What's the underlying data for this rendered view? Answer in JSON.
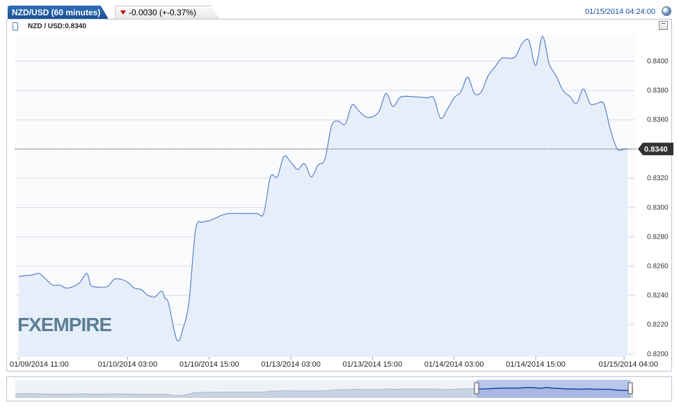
{
  "tab": {
    "pair_label": "NZD/USD (60 minutes)",
    "change_label": "-0.0030 (+-0.37%)",
    "datetime": "01/15/2014 04:24:00"
  },
  "colors": {
    "line": "#5a82c8",
    "fill": "#e6eefa",
    "tab": "#1b4f94",
    "down": "#cc0000",
    "label_bg": "#333333"
  },
  "logo_text": "FXEMPIRE",
  "chart_data": {
    "type": "area",
    "series_label": "NZD / USD:0.8340",
    "last_value_label": "0.8340",
    "last_value": 0.834,
    "ylim": [
      0.8198,
      0.8418
    ],
    "yticks": [
      "0.8200",
      "0.8220",
      "0.8240",
      "0.8260",
      "0.8280",
      "0.8300",
      "0.8320",
      "0.8340",
      "0.8360",
      "0.8380",
      "0.8400"
    ],
    "ytick_values": [
      0.82,
      0.822,
      0.824,
      0.826,
      0.828,
      0.83,
      0.832,
      0.834,
      0.836,
      0.838,
      0.84
    ],
    "xticks": [
      "01/09/2014 11:00",
      "01/10/2014 03:00",
      "01/10/2014 15:00",
      "01/13/2014 03:00",
      "01/13/2014 15:00",
      "01/14/2014 03:00",
      "01/14/2014 15:00",
      "01/15/2014 04:00"
    ],
    "x_hours_tick_positions": [
      0,
      16,
      28,
      40,
      52,
      64,
      76,
      89
    ],
    "points": [
      [
        0,
        0.8253
      ],
      [
        2,
        0.8254
      ],
      [
        3,
        0.8255
      ],
      [
        4,
        0.8251
      ],
      [
        5,
        0.8247
      ],
      [
        6,
        0.8247
      ],
      [
        7,
        0.8245
      ],
      [
        8,
        0.8246
      ],
      [
        9,
        0.8249
      ],
      [
        10,
        0.8255
      ],
      [
        10.5,
        0.8248
      ],
      [
        11,
        0.8246
      ],
      [
        13,
        0.8246
      ],
      [
        14,
        0.8251
      ],
      [
        15,
        0.8251
      ],
      [
        16,
        0.8249
      ],
      [
        17,
        0.8245
      ],
      [
        18,
        0.8244
      ],
      [
        19,
        0.824
      ],
      [
        20,
        0.8239
      ],
      [
        21,
        0.8243
      ],
      [
        21.5,
        0.8238
      ],
      [
        22,
        0.8235
      ],
      [
        23,
        0.8213
      ],
      [
        23.5,
        0.8209
      ],
      [
        24,
        0.8215
      ],
      [
        25,
        0.8235
      ],
      [
        26,
        0.8285
      ],
      [
        27,
        0.829
      ],
      [
        28,
        0.8291
      ],
      [
        29,
        0.8293
      ],
      [
        30,
        0.8295
      ],
      [
        31,
        0.8296
      ],
      [
        33,
        0.8296
      ],
      [
        35,
        0.8296
      ],
      [
        36,
        0.8296
      ],
      [
        37,
        0.8321
      ],
      [
        38,
        0.8321
      ],
      [
        39,
        0.8335
      ],
      [
        40,
        0.8331
      ],
      [
        41,
        0.8326
      ],
      [
        42,
        0.833
      ],
      [
        43,
        0.8321
      ],
      [
        44,
        0.8329
      ],
      [
        45,
        0.8333
      ],
      [
        46,
        0.8356
      ],
      [
        47,
        0.8359
      ],
      [
        48,
        0.8357
      ],
      [
        49,
        0.837
      ],
      [
        50,
        0.8366
      ],
      [
        51,
        0.8362
      ],
      [
        52,
        0.8362
      ],
      [
        53,
        0.8366
      ],
      [
        54,
        0.8378
      ],
      [
        55,
        0.8369
      ],
      [
        56,
        0.8375
      ],
      [
        57,
        0.8376
      ],
      [
        60,
        0.8375
      ],
      [
        61,
        0.8375
      ],
      [
        62,
        0.8361
      ],
      [
        63,
        0.8367
      ],
      [
        64,
        0.8375
      ],
      [
        65,
        0.8379
      ],
      [
        66,
        0.8389
      ],
      [
        67,
        0.8378
      ],
      [
        68,
        0.8379
      ],
      [
        69,
        0.839
      ],
      [
        70,
        0.8396
      ],
      [
        71,
        0.8402
      ],
      [
        72,
        0.8402
      ],
      [
        73,
        0.8403
      ],
      [
        74,
        0.8412
      ],
      [
        75,
        0.8414
      ],
      [
        76,
        0.8397
      ],
      [
        77,
        0.8417
      ],
      [
        78,
        0.8398
      ],
      [
        79,
        0.839
      ],
      [
        80,
        0.838
      ],
      [
        81,
        0.8376
      ],
      [
        82,
        0.8371
      ],
      [
        83,
        0.8381
      ],
      [
        84,
        0.8371
      ],
      [
        85,
        0.8371
      ],
      [
        86,
        0.8371
      ],
      [
        87,
        0.8353
      ],
      [
        88,
        0.834
      ],
      [
        89,
        0.834
      ],
      [
        89.5,
        0.834
      ]
    ]
  }
}
